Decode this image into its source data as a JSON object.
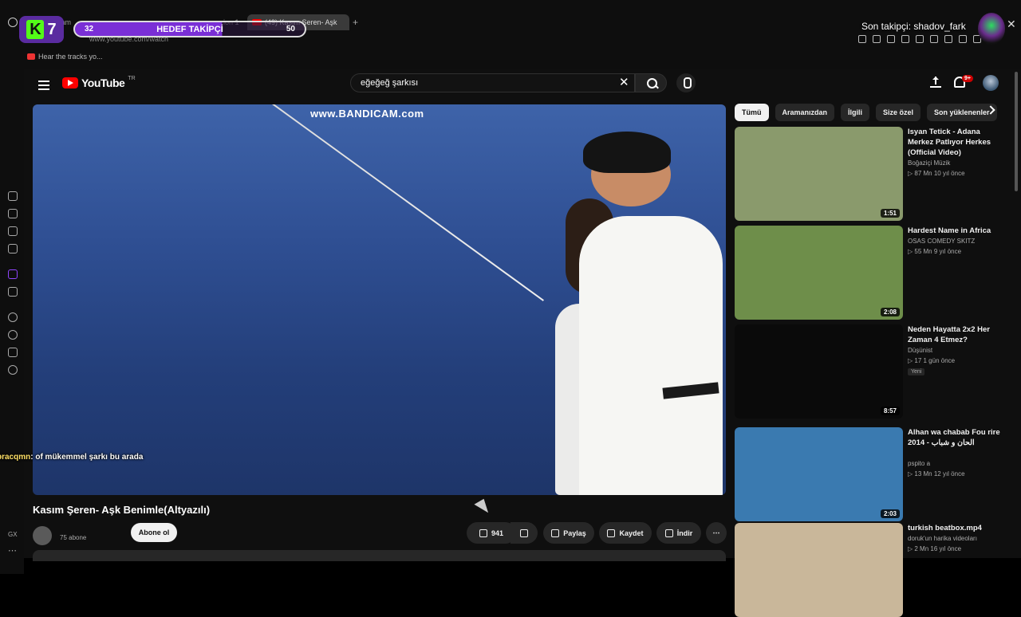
{
  "browser": {
    "tab_left": "Stream",
    "tab_mid": "ion 1",
    "yt_tab_label": "(49) Kasım Şeren- Aşk",
    "url": "www.youtube.com/watch",
    "bookmark": "Hear the tracks yo..."
  },
  "overlay": {
    "kick_number": "7",
    "goal_current": "32",
    "goal_label": "HEDEF TAKİPÇİ",
    "goal_target": "50",
    "last_follower": "Son takipçi: shadov_fark"
  },
  "youtube": {
    "logo": "YouTube",
    "region": "TR",
    "search_value": "eğeğeğ şarkısı",
    "notif_badge": "9+",
    "video_watermark": "www.BANDICAM.com",
    "video_title": "Kasım Şeren- Aşk Benimle(Altyazılı)",
    "subscribers": "75 abone",
    "subscribe_label": "Abone ol",
    "likes": "941",
    "share": "Paylaş",
    "save": "Kaydet",
    "download": "İndir"
  },
  "chat": {
    "user": "bracqmn",
    "message": ": of mükemmel şarkı bu arada"
  },
  "sidebar_left": {
    "bottom_label": "GX"
  },
  "chips": [
    "Tümü",
    "Aramanızdan",
    "İlgili",
    "Size özel",
    "Son yüklenenler"
  ],
  "recommendations": [
    {
      "title": "Isyan Tetick - Adana Merkez Patlıyor Herkes (Official Video)",
      "channel": "Boğaziçi Müzik",
      "meta": "▷ 87 Mn   10 yıl önce",
      "duration": "1:51",
      "thumb_color": "#8a9a6c"
    },
    {
      "title": "Hardest Name in Africa",
      "channel": "OSAS COMEDY SKITZ",
      "meta": "▷ 55 Mn   9 yıl önce",
      "duration": "2:08",
      "thumb_color": "#6e8e4a"
    },
    {
      "title": "Neden Hayatta 2x2 Her Zaman 4 Etmez?",
      "channel": "Düşünist",
      "meta": "▷ 17   1 gün önce",
      "duration": "8:57",
      "new": "Yeni",
      "thumb_color": "#0a0a0a"
    },
    {
      "title": "Alhan wa chabab Fou rire 2014 - الحان و شباب",
      "channel": "pspito a",
      "meta": "▷ 13 Mn   12 yıl önce",
      "duration": "2:03",
      "thumb_color": "#3a7ab0"
    },
    {
      "title": "turkish beatbox.mp4",
      "channel": "doruk'un harika videoları",
      "meta": "▷ 2 Mn   16 yıl önce",
      "duration": "",
      "thumb_color": "#c9b79a"
    }
  ]
}
